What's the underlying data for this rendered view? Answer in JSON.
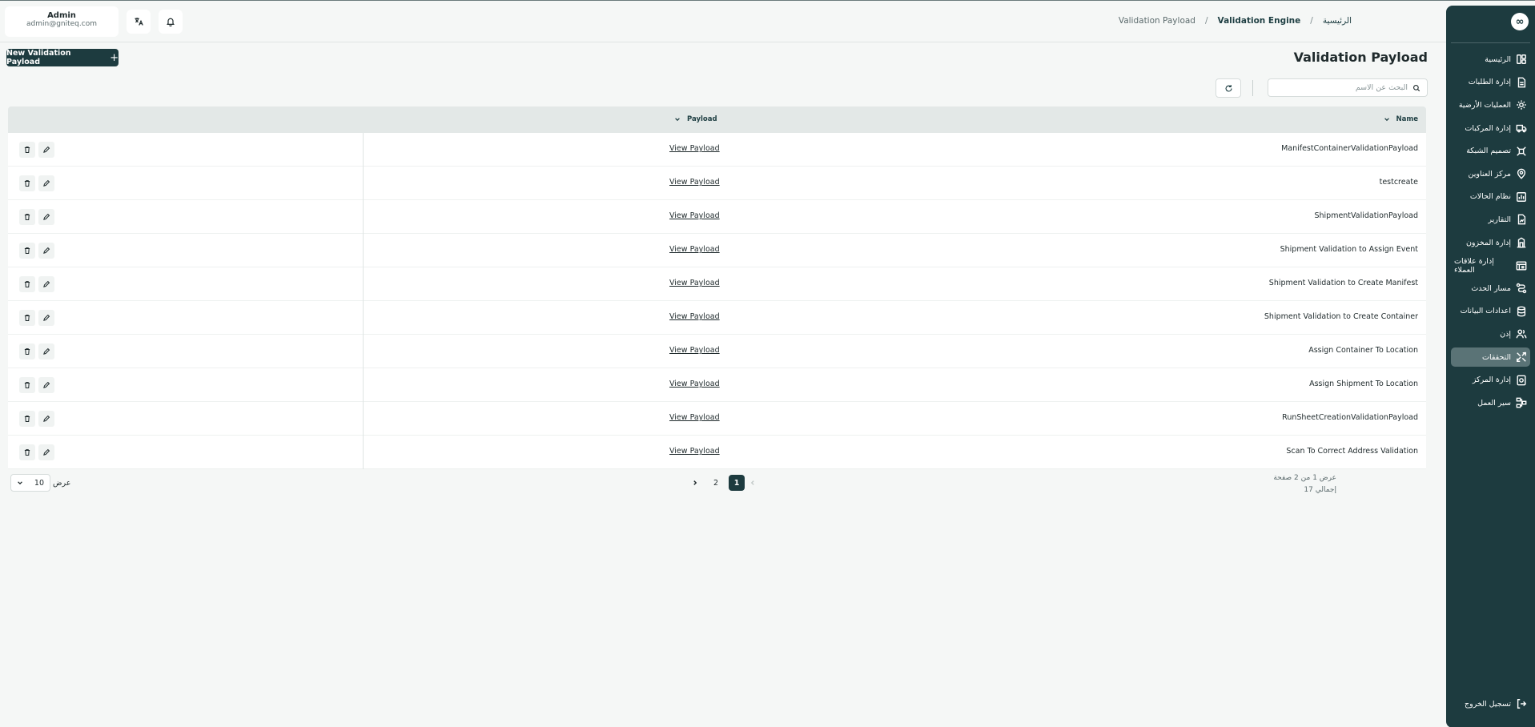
{
  "header": {
    "user_name": "Admin",
    "user_email": "admin@gniteq.com",
    "breadcrumb": {
      "home": "الرئيسية",
      "separator": "/",
      "engine": "Validation Engine",
      "current": "Validation Payload"
    }
  },
  "page": {
    "title": "Validation Payload",
    "new_button": "New Validation Payload",
    "search_placeholder": "البحث عن الاسم"
  },
  "table": {
    "columns": {
      "name": "Name",
      "payload": "Payload"
    },
    "view_label": "View Payload",
    "rows": [
      "ManifestContainerValidationPayload",
      "testcreate",
      "ShipmentValidationPayload",
      "Shipment Validation to Assign Event",
      "Shipment Validation to Create Manifest",
      "Shipment Validation to Create Container",
      "Assign Container To Location",
      "Assign Shipment To Location",
      "RunSheetCreationValidationPayload",
      "Scan To Correct Address Validation"
    ]
  },
  "pager": {
    "page_size_label": "عرض",
    "page_size": "10",
    "pages": [
      "1",
      "2"
    ],
    "current_page": "1",
    "info_line1": "عرض 1 من 2 صفحة",
    "info_line2": "إجمالي 17"
  },
  "sidebar": {
    "logo": "∞",
    "items": [
      {
        "label": "الرئيسية",
        "icon": "layout-icon"
      },
      {
        "label": "إدارة الطلبات",
        "icon": "orders-icon"
      },
      {
        "label": "العمليات الأرضية",
        "icon": "ground-ops-icon"
      },
      {
        "label": "إدارة المركبات",
        "icon": "truck-icon"
      },
      {
        "label": "تصميم الشبكة",
        "icon": "network-icon"
      },
      {
        "label": "مركز العناوين",
        "icon": "address-icon"
      },
      {
        "label": "نظام الحالات",
        "icon": "status-icon"
      },
      {
        "label": "التقارير",
        "icon": "reports-icon"
      },
      {
        "label": "إدارة المخزون",
        "icon": "inventory-icon"
      },
      {
        "label": "إدارة علاقات العملاء",
        "icon": "crm-icon"
      },
      {
        "label": "مسار الحدث",
        "icon": "event-path-icon"
      },
      {
        "label": "اعدادات البيانات",
        "icon": "database-icon"
      },
      {
        "label": "إذن",
        "icon": "users-icon"
      },
      {
        "label": "التحققات",
        "icon": "validation-icon",
        "active": true
      },
      {
        "label": "إدارة المركز",
        "icon": "hub-icon"
      },
      {
        "label": "سير العمل",
        "icon": "workflow-icon"
      }
    ],
    "logout": "تسجيل الخروج"
  },
  "colors": {
    "primary": "#1d3b3f",
    "active_item": "#5a7376",
    "background": "#f5f7f6"
  }
}
